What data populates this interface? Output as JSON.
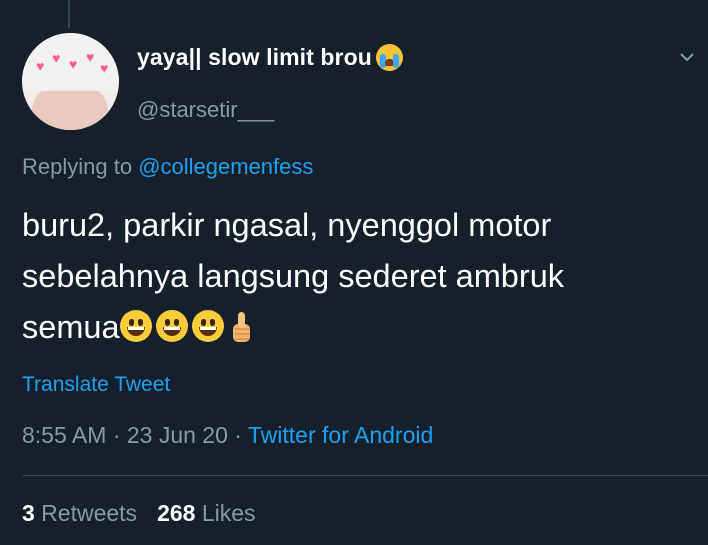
{
  "user": {
    "display_name": "yaya|| slow limit brou",
    "handle": "@starsetir___",
    "name_emoji": "loudly-crying-face-emoji"
  },
  "reply": {
    "prefix": "Replying to ",
    "target": "@collegemenfess"
  },
  "tweet": {
    "line1": "buru2, parkir ngasal, nyenggol motor",
    "line2": "sebelahnya langsung sederet ambruk",
    "line3": "semua",
    "trailing_emojis": [
      "grinning-face-emoji",
      "grinning-face-emoji",
      "grinning-face-emoji",
      "thumbs-up-emoji"
    ]
  },
  "translate_label": "Translate Tweet",
  "meta": {
    "time": "8:55 AM",
    "sep1": " · ",
    "date": "23 Jun 20",
    "sep2": " · ",
    "source": "Twitter for Android"
  },
  "stats": {
    "retweets_count": "3",
    "retweets_label": " Retweets",
    "likes_count": "268",
    "likes_label": " Likes"
  },
  "colors": {
    "background": "#15202b",
    "secondary_text": "#8899a6",
    "accent": "#1da1f2",
    "divider": "#38444d"
  }
}
